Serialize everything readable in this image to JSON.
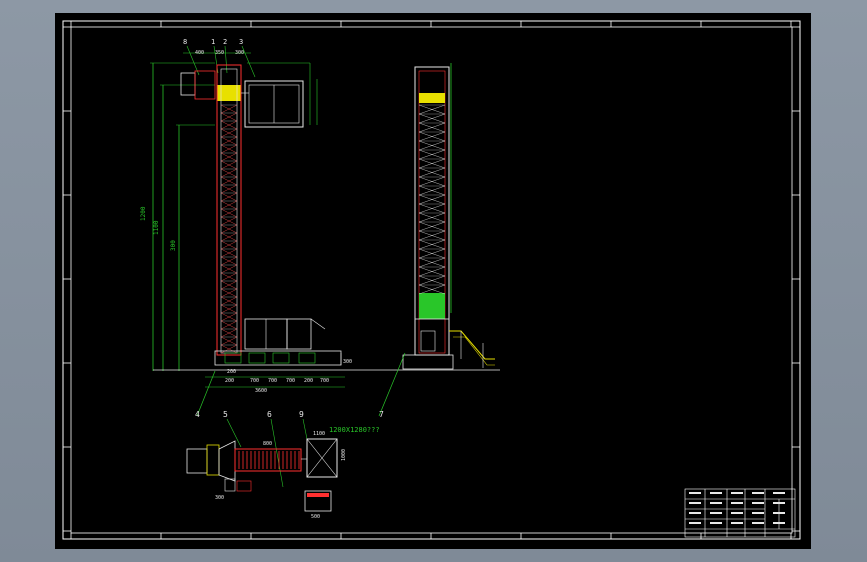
{
  "balloons": {
    "b1": "1",
    "b2": "2",
    "b3": "3",
    "b4": "4",
    "b5": "5",
    "b6": "6",
    "b7": "7",
    "b8": "8",
    "b9": "9"
  },
  "notes": {
    "chute": "1200X1280???"
  },
  "dims": {
    "top_a": "400",
    "top_b": "350",
    "top_c": "300",
    "overall_h": "1200",
    "mid_h": "1100",
    "low_h": "300",
    "base_1": "200",
    "base_2": "700",
    "base_3": "700",
    "base_4": "700",
    "base_5": "200",
    "base_6": "700",
    "base_total": "3600",
    "plan_a": "800",
    "plan_b": "1100",
    "plan_c": "1000",
    "plan_d": "300",
    "plan_e": "500"
  },
  "colors": {
    "green": "#29c629",
    "yellow": "#e8e000",
    "red": "#ff3030",
    "white": "#e8e8e8",
    "frame": "#ffffff"
  }
}
